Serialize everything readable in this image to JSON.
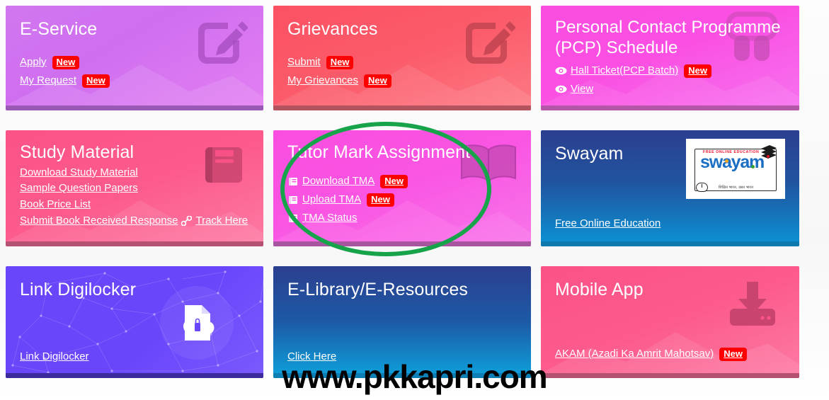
{
  "watermark": "www.pkkapri.com",
  "badge_label": "New",
  "cards": [
    {
      "id": "e-service",
      "title": "E-Service",
      "icon": "edit-square-icon",
      "links": [
        {
          "label": "Apply",
          "badge": "New",
          "icon": null
        },
        {
          "label": "My Request",
          "badge": "New",
          "icon": null
        }
      ],
      "accent": "#d277ef"
    },
    {
      "id": "grievances",
      "title": "Grievances",
      "icon": "edit-square-icon",
      "links": [
        {
          "label": "Submit",
          "badge": "New",
          "icon": null
        },
        {
          "label": "My Grievances",
          "badge": "New",
          "icon": null
        }
      ],
      "accent": "#fb5163"
    },
    {
      "id": "pcp-schedule",
      "title": "Personal Contact Programme (PCP) Schedule",
      "icon": "graduation-cap-icon",
      "links": [
        {
          "label": "Hall Ticket(PCP Batch)",
          "badge": "New",
          "icon": "eye-icon"
        },
        {
          "label": "View",
          "badge": null,
          "icon": "eye-icon"
        }
      ],
      "accent": "#fa4ee0"
    },
    {
      "id": "study-material",
      "title": "Study Material",
      "icon": "book-icon",
      "links": [
        {
          "label": "Download Study Material",
          "badge": null,
          "icon": null
        },
        {
          "label": "Sample Question Papers",
          "badge": null,
          "icon": null
        },
        {
          "label": "Book Price List",
          "badge": null,
          "icon": null
        },
        {
          "label": "Submit Book Received Response",
          "badge": null,
          "icon": null,
          "link_icon": "chain-link-icon",
          "extra_label": "Track Here"
        }
      ],
      "accent": "#fb5287"
    },
    {
      "id": "tutor-mark-assignment",
      "title": "Tutor Mark Assignment",
      "icon": "open-book-icon",
      "links": [
        {
          "label": "Download TMA",
          "badge": "New",
          "icon": "book-small-icon"
        },
        {
          "label": "Upload TMA",
          "badge": "New",
          "icon": "book-small-icon"
        },
        {
          "label": "TMA Status",
          "badge": null,
          "icon": "book-small-icon"
        }
      ],
      "accent": "#fa4ee0",
      "highlighted": true
    },
    {
      "id": "swayam",
      "title": "Swayam",
      "icon": "swayam-logo",
      "logo": {
        "tagline": "FREE ONLINE EDUCATION",
        "wordmark": "swayam",
        "subtitle": "शिक्षित भारत, उन्नत भारत"
      },
      "links": [
        {
          "label": "Free Online Education",
          "badge": null,
          "icon": null
        }
      ],
      "accent": "#20549f"
    },
    {
      "id": "link-digilocker",
      "title": "Link Digilocker",
      "icon": "document-cloud-lock-icon",
      "links": [
        {
          "label": "Link Digilocker",
          "badge": null,
          "icon": null
        }
      ],
      "accent": "#6a46fb"
    },
    {
      "id": "e-library",
      "title": "E-Library/E-Resources",
      "icon": null,
      "links": [
        {
          "label": "Click Here",
          "badge": null,
          "icon": null
        }
      ],
      "accent": "#1c5aa6"
    },
    {
      "id": "mobile-app",
      "title": "Mobile App",
      "icon": "download-tray-icon",
      "links": [
        {
          "label": "AKAM (Azadi Ka Amrit Mahotsav)",
          "badge": "New",
          "icon": null
        }
      ],
      "accent": "#fb5287"
    }
  ],
  "annotation": {
    "type": "ellipse-highlight",
    "color": "#16a34a",
    "target": "tutor-mark-assignment"
  }
}
